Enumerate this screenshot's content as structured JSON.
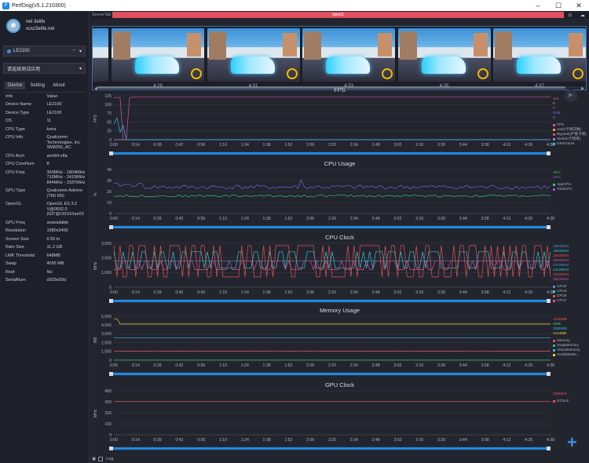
{
  "window": {
    "title": "PerfDog(v5.1.210300)",
    "minimize": "–",
    "maximize": "☐",
    "close": "✕"
  },
  "user": {
    "name": "net 3elife",
    "mail": "xcxz3elife.net"
  },
  "device_select": {
    "value": "LE2100"
  },
  "app_select": {
    "value": "请选择测试应用"
  },
  "tabs": [
    "Device",
    "Setting",
    "About"
  ],
  "info_table": {
    "headers": [
      "Info",
      "Value"
    ],
    "rows": [
      {
        "k": "Device Name",
        "v": "LE2100"
      },
      {
        "k": "Device Type",
        "v": "LE2100"
      },
      {
        "k": "OS",
        "v": "11"
      },
      {
        "k": "CPU Type",
        "v": "kona"
      },
      {
        "k": "CPU Info",
        "v": "Qualcomm\nTechnologies, Inc\nSM8250_AC"
      },
      {
        "k": "CPU Arch",
        "v": "arm64-v8a"
      },
      {
        "k": "CPU CoreNum",
        "v": "8"
      },
      {
        "k": "CPU Freq",
        "v": "300MHz - 1804MHz\n710MHz - 2419MHz\n844MHz - 3187MHz"
      },
      {
        "k": "GPU Type",
        "v": "Qualcomm Adreno\n(TM) 650"
      },
      {
        "k": "OpenGL",
        "v": "OpenGL ES 3.2\nV@0502.0\n(GIT@191610ae03"
      },
      {
        "k": "GPU Freq",
        "v": "unavailable"
      },
      {
        "k": "Resolution",
        "v": "1080x2400"
      },
      {
        "k": "Screen Size",
        "v": "6.55 in"
      },
      {
        "k": "Ram Size",
        "v": "11.2 GB"
      },
      {
        "k": "LMK Threshold",
        "v": "648MB"
      },
      {
        "k": "Swap",
        "v": "4095 MB"
      },
      {
        "k": "Root",
        "v": "No"
      },
      {
        "k": "SerialNum",
        "v": "d303e93d"
      }
    ]
  },
  "scene": {
    "label": "SceneTab",
    "tag": "label1"
  },
  "thumbnails": {
    "times": [
      "4:29",
      "4:31",
      "4:33",
      "4:35",
      "4:37"
    ]
  },
  "time_ticks": [
    "0:00",
    "0:14",
    "0:28",
    "0:42",
    "0:56",
    "1:10",
    "1:24",
    "1:38",
    "1:52",
    "2:06",
    "2:20",
    "2:34",
    "2:48",
    "3:02",
    "3:16",
    "3:30",
    "3:44",
    "3:58",
    "4:12",
    "4:26",
    "4:38"
  ],
  "chart_data": [
    {
      "type": "line",
      "title": "FPS",
      "ylabel": "FPS",
      "ylim": [
        0,
        125
      ],
      "yticks": [
        "125",
        "100",
        "75",
        "50",
        "25",
        "0"
      ],
      "series": [
        {
          "name": "FPS",
          "color": "#d64fa4"
        },
        {
          "name": "Jank(卡顿次数)",
          "color": "#e8a33c"
        },
        {
          "name": "BigJank(严重卡顿)",
          "color": "#e05353"
        },
        {
          "name": "Stutter(卡顿率)",
          "color": "#9b6fe0"
        },
        {
          "name": "InterFrame",
          "color": "#35b7e0"
        }
      ],
      "values": [
        "121",
        "0",
        "0",
        "0:00",
        "0"
      ]
    },
    {
      "type": "line",
      "title": "CPU Usage",
      "ylabel": "%",
      "ylim": [
        0,
        40
      ],
      "yticks": [
        "40",
        "30",
        "20",
        "10",
        "0"
      ],
      "series": [
        {
          "name": "AppCPU",
          "color": "#36c26d"
        },
        {
          "name": "TotalCPU",
          "color": "#6f63e0"
        }
      ],
      "values": [
        "15%",
        "23%"
      ]
    },
    {
      "type": "line",
      "title": "CPU Clock",
      "ylabel": "MHz",
      "ylim": [
        0,
        3000
      ],
      "yticks": [
        "3,000",
        "2,000",
        "1,000",
        "0"
      ],
      "series": [
        {
          "name": "CPU0",
          "color": "#4a90d9"
        },
        {
          "name": "CPU4",
          "color": "#2fc6c6"
        },
        {
          "name": "CPU5",
          "color": "#e05353"
        },
        {
          "name": "CPU7",
          "color": "#d64fa4"
        }
      ],
      "values": [
        "1804MHz",
        "1804MHz",
        "1804MHz",
        "1804MHz",
        "2419MHz",
        "2419MHz",
        "2419MHz",
        "2841MHz"
      ]
    },
    {
      "type": "line",
      "title": "Memory Usage",
      "ylabel": "MB",
      "ylim": [
        0,
        5000
      ],
      "yticks": [
        "5,000",
        "4,000",
        "3,000",
        "2,000",
        "1,000",
        "0"
      ],
      "series": [
        {
          "name": "Memory",
          "color": "#e05353"
        },
        {
          "name": "SwapMemory",
          "color": "#36c26d"
        },
        {
          "name": "VirtualMemory",
          "color": "#35b7e0"
        },
        {
          "name": "AvailableMe...",
          "color": "#e8d13c"
        }
      ],
      "values": [
        "1025MB",
        "9MB",
        "2565MB",
        "4114MB"
      ]
    },
    {
      "type": "line",
      "title": "GPU Clock",
      "ylabel": "MHz",
      "ylim": [
        0,
        400
      ],
      "yticks": [
        "400",
        "300",
        "200",
        "100",
        "0"
      ],
      "series": [
        {
          "name": "GClock",
          "color": "#e05353"
        }
      ],
      "values": [
        "305MHz"
      ]
    }
  ],
  "bottom": {
    "log": "Log"
  }
}
